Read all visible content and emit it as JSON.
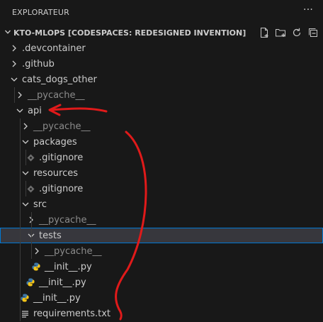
{
  "panel": {
    "title": "EXPLORATEUR",
    "more_label": "···"
  },
  "workspace": {
    "title": "KTO-MLOPS [CODESPACES: REDESIGNED INVENTION]",
    "actions": [
      "new-file-icon",
      "new-folder-icon",
      "refresh-icon",
      "collapse-all-icon"
    ]
  },
  "tree": [
    {
      "label": ".devcontainer",
      "type": "folder",
      "expanded": false
    },
    {
      "label": ".github",
      "type": "folder",
      "expanded": false
    },
    {
      "label": "cats_dogs_other",
      "type": "folder",
      "expanded": true
    },
    {
      "label": "__pycache__",
      "type": "folder",
      "expanded": false,
      "muted": true
    },
    {
      "label": "api",
      "type": "folder",
      "expanded": true
    },
    {
      "label": "__pycache__",
      "type": "folder",
      "expanded": false,
      "muted": true
    },
    {
      "label": "packages",
      "type": "folder",
      "expanded": true
    },
    {
      "label": ".gitignore",
      "type": "file",
      "icon": "gitignore-icon"
    },
    {
      "label": "resources",
      "type": "folder",
      "expanded": true
    },
    {
      "label": ".gitignore",
      "type": "file",
      "icon": "gitignore-icon"
    },
    {
      "label": "src",
      "type": "folder",
      "expanded": true
    },
    {
      "label": "__pycache__",
      "type": "folder",
      "expanded": false,
      "muted": true
    },
    {
      "label": "tests",
      "type": "folder",
      "expanded": true,
      "selected": true
    },
    {
      "label": "__pycache__",
      "type": "folder",
      "expanded": false,
      "muted": true
    },
    {
      "label": "__init__.py",
      "type": "file",
      "icon": "python-file-icon"
    },
    {
      "label": "__init__.py",
      "type": "file",
      "icon": "python-file-icon"
    },
    {
      "label": "__init__.py",
      "type": "file",
      "icon": "python-file-icon"
    },
    {
      "label": "requirements.txt",
      "type": "file",
      "icon": "text-file-icon"
    }
  ],
  "colors": {
    "background": "#181818",
    "selection_border": "#0078d4",
    "python_blue": "#3c78aa",
    "python_yellow": "#f5c518",
    "annotation_red": "#e01a1a"
  }
}
